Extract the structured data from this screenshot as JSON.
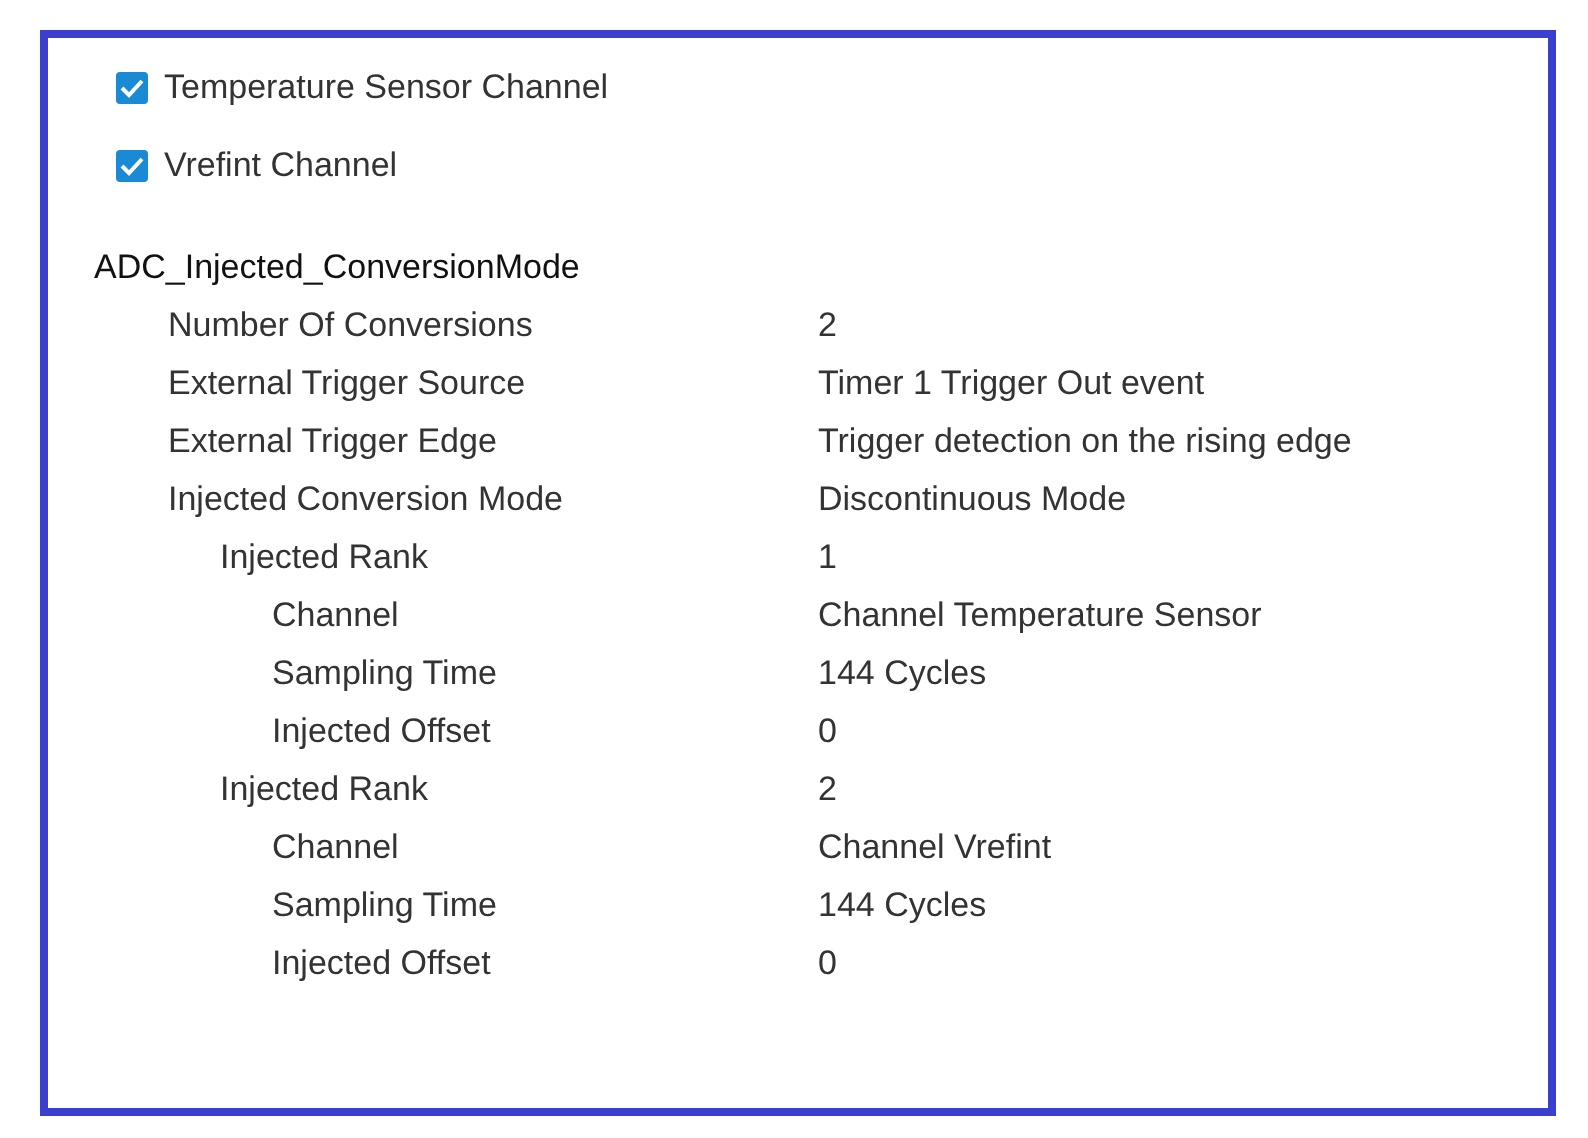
{
  "checkboxes": [
    {
      "label": "Temperature Sensor Channel",
      "checked": true
    },
    {
      "label": "Vrefint Channel",
      "checked": true
    }
  ],
  "tree": {
    "label": "ADC_Injected_ConversionMode",
    "children": [
      {
        "label": "Number Of Conversions",
        "value": "2"
      },
      {
        "label": "External Trigger Source",
        "value": "Timer 1 Trigger Out event"
      },
      {
        "label": "External Trigger Edge",
        "value": "Trigger detection on the rising edge"
      },
      {
        "label": "Injected Conversion Mode",
        "value": "Discontinuous Mode",
        "children": [
          {
            "label": "Injected Rank",
            "value": "1",
            "children": [
              {
                "label": "Channel",
                "value": "Channel Temperature Sensor"
              },
              {
                "label": "Sampling Time",
                "value": "144 Cycles"
              },
              {
                "label": "Injected Offset",
                "value": "0"
              }
            ]
          },
          {
            "label": "Injected Rank",
            "value": "2",
            "children": [
              {
                "label": "Channel",
                "value": "Channel Vrefint"
              },
              {
                "label": "Sampling Time",
                "value": "144 Cycles"
              },
              {
                "label": "Injected Offset",
                "value": "0"
              }
            ]
          }
        ]
      }
    ]
  }
}
